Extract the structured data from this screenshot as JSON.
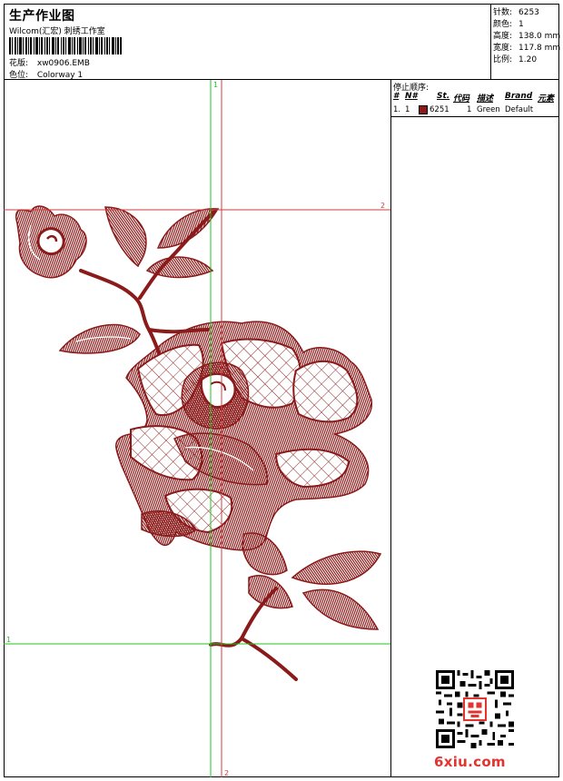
{
  "header": {
    "title": "生产作业图",
    "company": "Wilcom(汇宏) 刺绣工作室",
    "design_label": "花版:",
    "design_value": "xw0906.EMB",
    "colorway_label": "色位:",
    "colorway_value": "Colorway 1"
  },
  "stats": [
    {
      "label": "针数:",
      "value": "6253"
    },
    {
      "label": "颜色:",
      "value": "1"
    },
    {
      "label": "高度:",
      "value": "138.0 mm"
    },
    {
      "label": "宽度:",
      "value": "117.8 mm"
    },
    {
      "label": "比例:",
      "value": "1.20"
    }
  ],
  "stop_sequence": {
    "title": "停止顺序:",
    "columns": [
      "#",
      "N#",
      "St.",
      "代码",
      "描述",
      "Brand",
      "元素"
    ],
    "rows": [
      {
        "index": "1.",
        "needle": "1",
        "stitches": "6251",
        "code": "1",
        "description": "Green",
        "brand": "Default",
        "color": "#8b1a1a"
      }
    ]
  },
  "guides": {
    "v1": "1",
    "v2": "2",
    "h1": "1",
    "h2": "2"
  },
  "colors": {
    "thread": "#8b1a1a",
    "guide_green": "#22c322",
    "guide_red": "#d23c3c",
    "watermark": "#e3342f"
  },
  "watermark": {
    "site": "6xiu.com"
  }
}
